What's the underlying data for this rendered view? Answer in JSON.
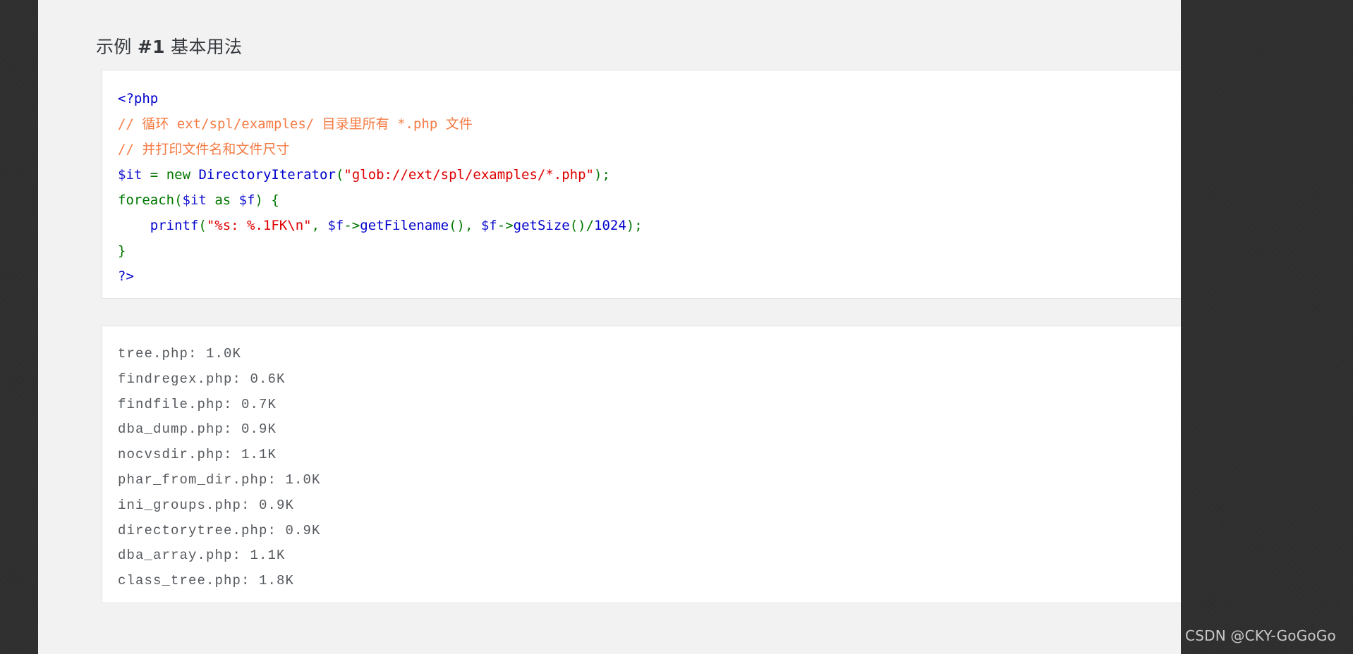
{
  "page": {
    "title_prefix": "示例 ",
    "title_number": "#1",
    "title_suffix": " 基本用法",
    "watermark": "CSDN @CKY-GoGoGo",
    "background_color": "#2e2e2e",
    "article_background": "#f2f2f2",
    "panel_background": "#ffffff",
    "panel_border_color": "#e3e3e3"
  },
  "code_block": {
    "language": "php",
    "colors": {
      "tag": "#0000cd",
      "comment": "#f57a42",
      "variable": "#1414cf",
      "keyword": "#007700",
      "function": "#0000cd",
      "punctuation": "#007700",
      "string": "#dd0000",
      "number": "#0000cd"
    },
    "lines": [
      {
        "tokens": [
          {
            "t": "<?php",
            "c": "tok-tag"
          }
        ]
      },
      {
        "tokens": [
          {
            "t": "// 循环 ext/spl/examples/ 目录里所有 *.php 文件",
            "c": "tok-comment"
          }
        ]
      },
      {
        "tokens": [
          {
            "t": "// 并打印文件名和文件尺寸",
            "c": "tok-comment"
          }
        ]
      },
      {
        "tokens": [
          {
            "t": "$it",
            "c": "tok-var"
          },
          {
            "t": " ",
            "c": ""
          },
          {
            "t": "=",
            "c": "tok-op"
          },
          {
            "t": " ",
            "c": ""
          },
          {
            "t": "new",
            "c": "tok-keyword"
          },
          {
            "t": " ",
            "c": ""
          },
          {
            "t": "DirectoryIterator",
            "c": "tok-fn"
          },
          {
            "t": "(",
            "c": "tok-punct"
          },
          {
            "t": "\"glob://ext/spl/examples/*.php\"",
            "c": "tok-string"
          },
          {
            "t": ");",
            "c": "tok-punct"
          }
        ]
      },
      {
        "tokens": [
          {
            "t": "foreach",
            "c": "tok-keyword"
          },
          {
            "t": "(",
            "c": "tok-punct"
          },
          {
            "t": "$it",
            "c": "tok-var"
          },
          {
            "t": " ",
            "c": ""
          },
          {
            "t": "as",
            "c": "tok-keyword"
          },
          {
            "t": " ",
            "c": ""
          },
          {
            "t": "$f",
            "c": "tok-var"
          },
          {
            "t": ") {",
            "c": "tok-punct"
          }
        ]
      },
      {
        "tokens": [
          {
            "t": "    ",
            "c": ""
          },
          {
            "t": "printf",
            "c": "tok-fn"
          },
          {
            "t": "(",
            "c": "tok-punct"
          },
          {
            "t": "\"%s: %.1FK\\n\"",
            "c": "tok-string"
          },
          {
            "t": ", ",
            "c": "tok-punct"
          },
          {
            "t": "$f",
            "c": "tok-var"
          },
          {
            "t": "->",
            "c": "tok-op"
          },
          {
            "t": "getFilename",
            "c": "tok-fn"
          },
          {
            "t": "(), ",
            "c": "tok-punct"
          },
          {
            "t": "$f",
            "c": "tok-var"
          },
          {
            "t": "->",
            "c": "tok-op"
          },
          {
            "t": "getSize",
            "c": "tok-fn"
          },
          {
            "t": "()/",
            "c": "tok-punct"
          },
          {
            "t": "1024",
            "c": "tok-num"
          },
          {
            "t": ");",
            "c": "tok-punct"
          }
        ]
      },
      {
        "tokens": [
          {
            "t": "}",
            "c": "tok-punct"
          }
        ]
      },
      {
        "tokens": [
          {
            "t": "?>",
            "c": "tok-tag"
          }
        ]
      }
    ]
  },
  "output_block": {
    "lines": [
      "tree.php: 1.0K",
      "findregex.php: 0.6K",
      "findfile.php: 0.7K",
      "dba_dump.php: 0.9K",
      "nocvsdir.php: 1.1K",
      "phar_from_dir.php: 1.0K",
      "ini_groups.php: 0.9K",
      "directorytree.php: 0.9K",
      "dba_array.php: 1.1K",
      "class_tree.php: 1.8K"
    ]
  }
}
